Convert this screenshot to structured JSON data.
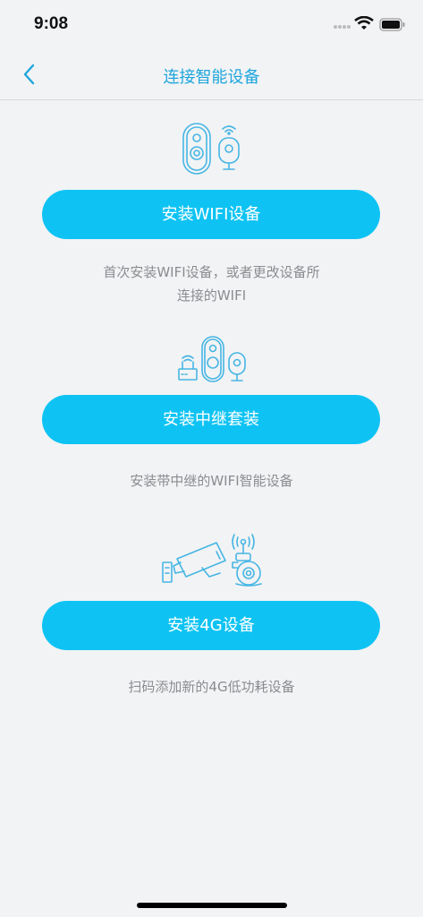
{
  "status": {
    "time": "9:08"
  },
  "nav": {
    "title": "连接智能设备"
  },
  "sections": [
    {
      "button": "安装WIFI设备",
      "desc_line1": "首次安装WIFI设备，或者更改设备所",
      "desc_line2": "连接的WIFI"
    },
    {
      "button": "安装中继套装",
      "desc": "安装带中继的WIFI智能设备"
    },
    {
      "button": "安装4G设备",
      "desc": "扫码添加新的4G低功耗设备"
    }
  ],
  "colors": {
    "accent": "#0ec3f3",
    "title": "#1ea6dc",
    "icon_stroke": "#46b6e4"
  }
}
